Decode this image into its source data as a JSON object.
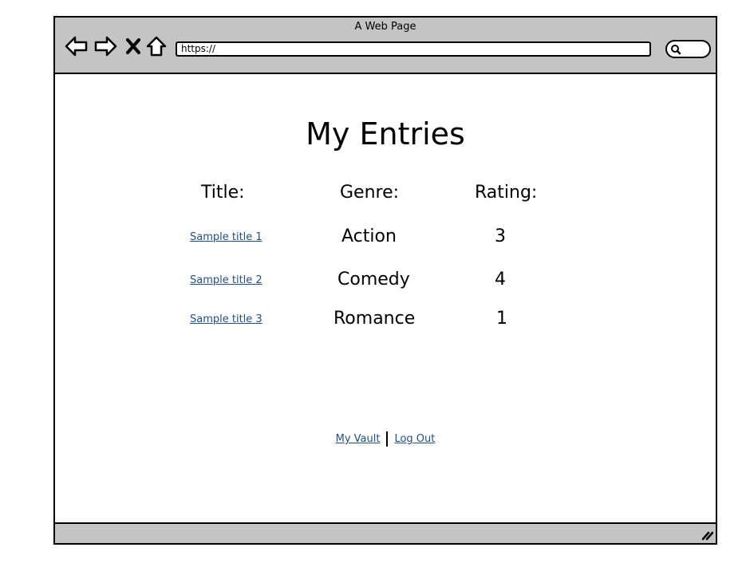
{
  "window": {
    "title": "A Web Page"
  },
  "toolbar": {
    "back_icon": "arrow-left-icon",
    "forward_icon": "arrow-right-icon",
    "stop_icon": "close-icon",
    "home_icon": "home-icon",
    "address_value": "https://",
    "search_icon": "search-icon"
  },
  "page": {
    "heading": "My Entries",
    "columns": {
      "title": "Title:",
      "genre": "Genre:",
      "rating": "Rating:"
    },
    "entries": [
      {
        "title": "Sample title 1",
        "genre": "Action",
        "rating": "3"
      },
      {
        "title": "Sample title 2",
        "genre": "Comedy",
        "rating": "4"
      },
      {
        "title": "Sample title 3",
        "genre": "Romance",
        "rating": "1"
      }
    ]
  },
  "footer": {
    "vault_link": "My Vault",
    "logout_link": "Log Out"
  },
  "statusbar": {
    "resize_icon": "resize-grip-icon"
  }
}
